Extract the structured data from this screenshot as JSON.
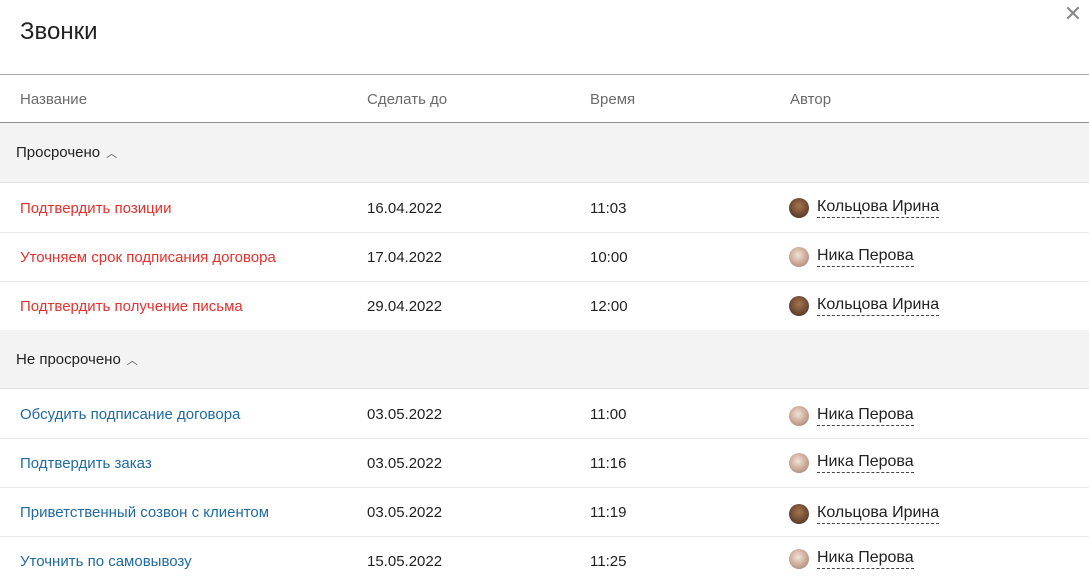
{
  "title": "Звонки",
  "columns": [
    "Название",
    "Сделать до",
    "Время",
    "Автор"
  ],
  "groups": [
    {
      "label": "Просрочено",
      "rows": [
        {
          "name": "Подтвердить позиции",
          "date": "16.04.2022",
          "time": "11:03",
          "author": "Кольцова Ирина"
        },
        {
          "name": "Уточняем срок подписания договора",
          "date": "17.04.2022",
          "time": "10:00",
          "author": "Ника Перова"
        },
        {
          "name": "Подтвердить получение письма",
          "date": "29.04.2022",
          "time": "12:00",
          "author": "Кольцова Ирина"
        }
      ]
    },
    {
      "label": "Не просрочено",
      "rows": [
        {
          "name": "Обсудить подписание договора",
          "date": "03.05.2022",
          "time": "11:00",
          "author": "Ника Перова"
        },
        {
          "name": "Подтвердить заказ",
          "date": "03.05.2022",
          "time": "11:16",
          "author": "Ника Перова"
        },
        {
          "name": "Приветственный созвон с клиентом",
          "date": "03.05.2022",
          "time": "11:19",
          "author": "Кольцова Ирина"
        },
        {
          "name": "Уточнить по самовывозу",
          "date": "15.05.2022",
          "time": "11:25",
          "author": "Ника Перова"
        }
      ]
    }
  ],
  "icons": {
    "close": "close-icon",
    "collapse": "chevron-up-icon",
    "avatar": "user-avatar"
  },
  "colors": {
    "overdue": "#e3312f",
    "link": "#1f6aa0",
    "group_bg": "#f3f3f3"
  }
}
